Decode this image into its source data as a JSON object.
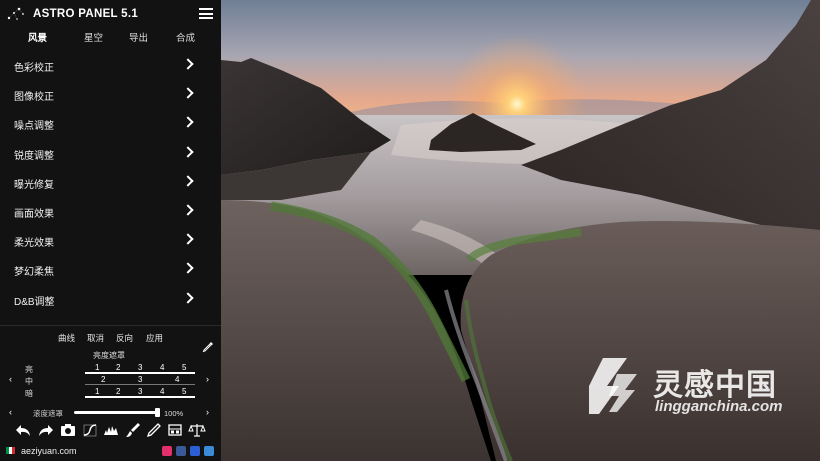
{
  "app": {
    "title": "ASTRO PANEL 5.1"
  },
  "tabs": [
    {
      "label": "风景",
      "active": true
    },
    {
      "label": "星空"
    },
    {
      "label": "导出"
    },
    {
      "label": "合成"
    }
  ],
  "sections": [
    {
      "label": "色彩校正"
    },
    {
      "label": "图像校正"
    },
    {
      "label": "噪点调整"
    },
    {
      "label": "锐度调整"
    },
    {
      "label": "曝光修复"
    },
    {
      "label": "画面效果"
    },
    {
      "label": "柔光效果"
    },
    {
      "label": "梦幻柔焦"
    },
    {
      "label": "D&B调整"
    }
  ],
  "actions": [
    "曲线",
    "取消",
    "反向",
    "应用"
  ],
  "mask": {
    "title": "亮度遮罩",
    "rows": [
      {
        "label": "亮",
        "numbers": [
          "1",
          "2",
          "3",
          "4",
          "5"
        ]
      },
      {
        "label": "中",
        "numbers": [
          "2",
          "3",
          "4"
        ]
      },
      {
        "label": "暗",
        "numbers": [
          "1",
          "2",
          "3",
          "4",
          "5"
        ]
      }
    ]
  },
  "saturation": {
    "label": "滚度遮罩",
    "value": "100%",
    "level": 1.0
  },
  "toolbar": {
    "icons": [
      "undo-icon",
      "redo-icon",
      "camera-icon",
      "curves-icon",
      "histogram-icon",
      "brush-icon",
      "pen-icon",
      "film-icon",
      "balance-icon"
    ]
  },
  "footer": {
    "site": "aeziyuan.com",
    "social_icons": [
      "instagram-icon",
      "facebook-icon",
      "flickr-icon",
      "email-icon"
    ]
  },
  "watermark": {
    "cn": "灵感中国",
    "en": "lingganchina.com"
  },
  "colors": {
    "panel_bg": "#121212",
    "text": "#ffffff",
    "instagram": "#e1306c",
    "facebook": "#3b5998",
    "flickr": "#2c5fd6",
    "email": "#3b8bd6"
  }
}
